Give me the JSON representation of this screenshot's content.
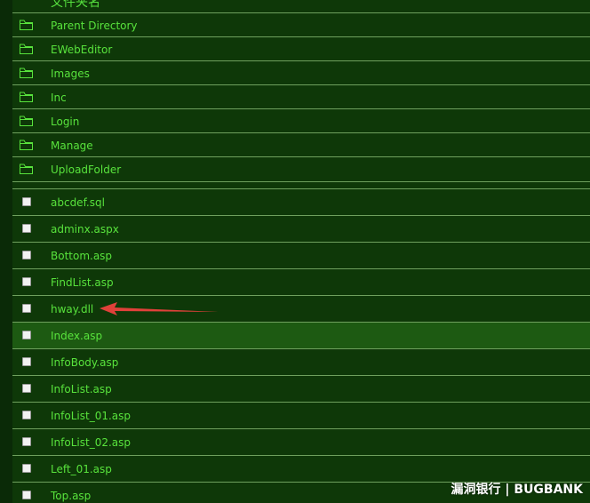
{
  "header": {
    "title": "文件夹名"
  },
  "folders": [
    {
      "name": "Parent Directory"
    },
    {
      "name": "EWebEditor"
    },
    {
      "name": "Images"
    },
    {
      "name": "Inc"
    },
    {
      "name": "Login"
    },
    {
      "name": "Manage"
    },
    {
      "name": "UploadFolder"
    }
  ],
  "files": [
    {
      "name": "abcdef.sql"
    },
    {
      "name": "adminx.aspx"
    },
    {
      "name": "Bottom.asp"
    },
    {
      "name": "FindList.asp"
    },
    {
      "name": "hway.dll"
    },
    {
      "name": "Index.asp"
    },
    {
      "name": "InfoBody.asp"
    },
    {
      "name": "InfoList.asp"
    },
    {
      "name": "InfoList_01.asp"
    },
    {
      "name": "InfoList_02.asp"
    },
    {
      "name": "Left_01.asp"
    },
    {
      "name": "Top.asp"
    }
  ],
  "highlighted_file": "Index.asp",
  "annotation": {
    "type": "arrow",
    "points_to": "hway.dll",
    "color": "#e0413a"
  },
  "watermark": {
    "text": "漏洞银行 | BUGBANK"
  },
  "colors": {
    "background": "#0e3808",
    "text": "#58e33c",
    "row_border": "#6fa05e",
    "highlight": "#1d5a12"
  },
  "icons": {
    "folder": "folder-icon",
    "file": "checkbox"
  }
}
